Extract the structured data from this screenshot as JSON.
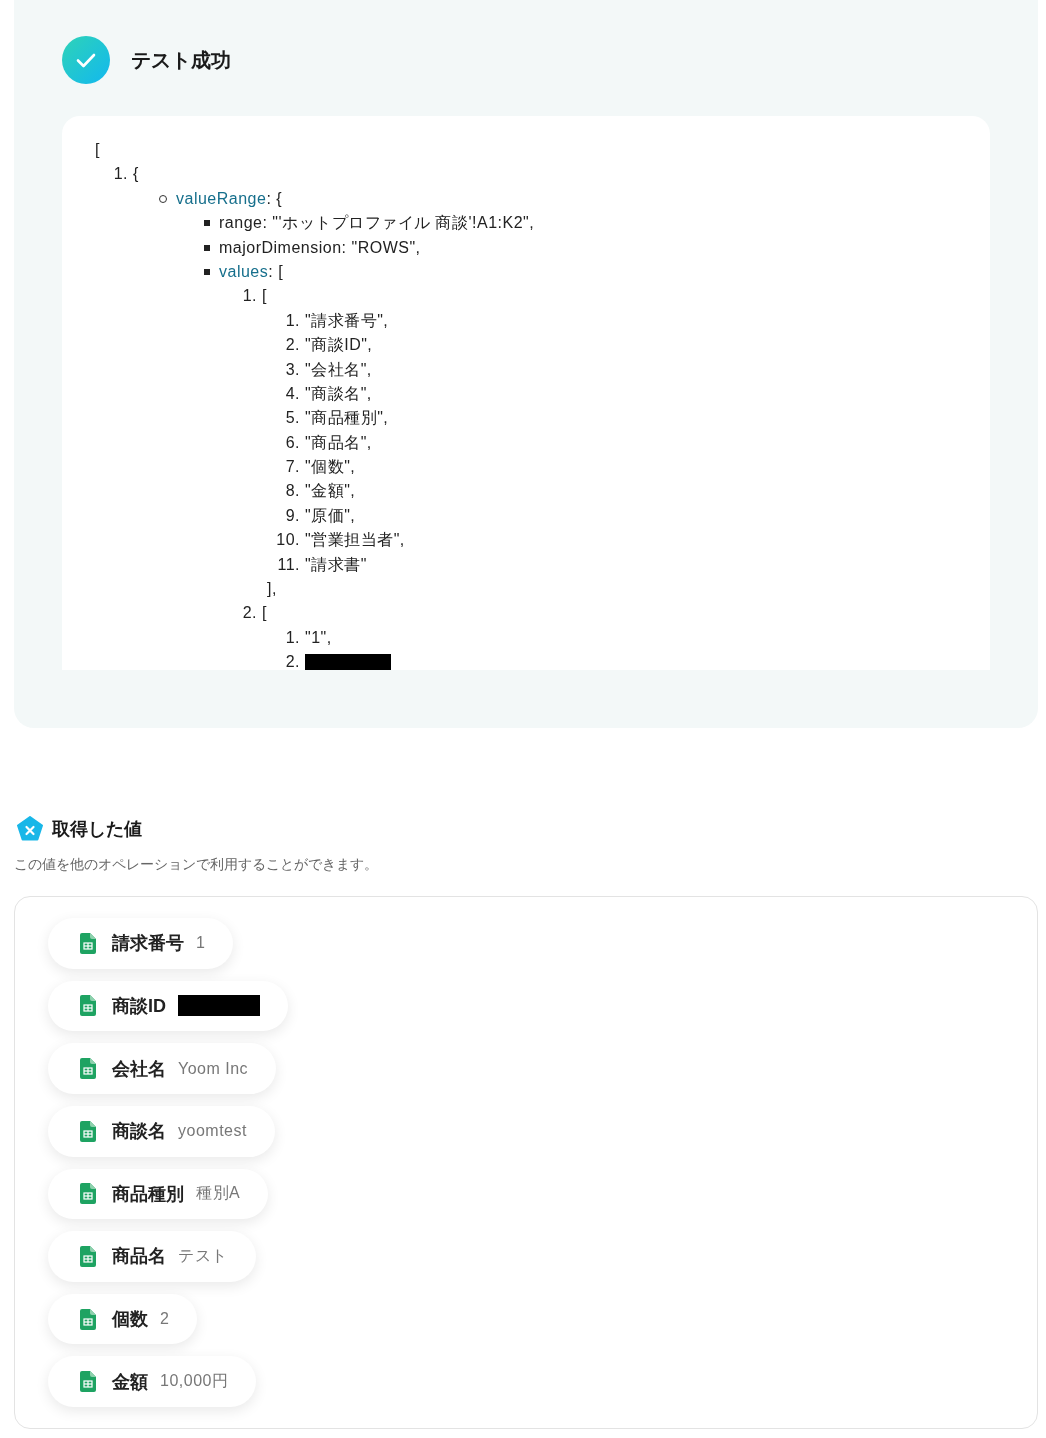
{
  "result": {
    "title": "テスト成功",
    "code": {
      "open": "[",
      "items": [
        {
          "kind": "numbered",
          "number": "1.",
          "text": "{",
          "children": [
            {
              "kind": "circle",
              "key": "valueRange",
              "text": ": {",
              "children": [
                {
                  "kind": "square",
                  "text": "range: \"'ホットプロファイル 商談'!A1:K2\","
                },
                {
                  "kind": "square",
                  "text": "majorDimension: \"ROWS\","
                },
                {
                  "kind": "square",
                  "key": "values",
                  "text": ": [",
                  "children": [
                    {
                      "kind": "numbered",
                      "number": "1.",
                      "text": "[",
                      "close": "],",
                      "children": [
                        {
                          "kind": "numbered",
                          "number": "1.",
                          "text": "\"請求番号\","
                        },
                        {
                          "kind": "numbered",
                          "number": "2.",
                          "text": "\"商談ID\","
                        },
                        {
                          "kind": "numbered",
                          "number": "3.",
                          "text": "\"会社名\","
                        },
                        {
                          "kind": "numbered",
                          "number": "4.",
                          "text": "\"商談名\","
                        },
                        {
                          "kind": "numbered",
                          "number": "5.",
                          "text": "\"商品種別\","
                        },
                        {
                          "kind": "numbered",
                          "number": "6.",
                          "text": "\"商品名\","
                        },
                        {
                          "kind": "numbered",
                          "number": "7.",
                          "text": "\"個数\","
                        },
                        {
                          "kind": "numbered",
                          "number": "8.",
                          "text": "\"金額\","
                        },
                        {
                          "kind": "numbered",
                          "number": "9.",
                          "text": "\"原価\","
                        },
                        {
                          "kind": "numbered",
                          "number": "10.",
                          "text": "\"営業担当者\","
                        },
                        {
                          "kind": "numbered",
                          "number": "11.",
                          "text": "\"請求書\""
                        }
                      ]
                    },
                    {
                      "kind": "numbered",
                      "number": "2.",
                      "text": "[",
                      "children": [
                        {
                          "kind": "numbered",
                          "number": "1.",
                          "text": "\"1\","
                        },
                        {
                          "kind": "numbered",
                          "number": "2.",
                          "redacted": true
                        }
                      ]
                    }
                  ]
                }
              ]
            }
          ]
        }
      ]
    }
  },
  "values_section": {
    "title": "取得した値",
    "description": "この値を他のオペレーションで利用することができます。",
    "fields": [
      {
        "label": "請求番号",
        "value": "1"
      },
      {
        "label": "商談ID",
        "redacted": true
      },
      {
        "label": "会社名",
        "value": "Yoom Inc"
      },
      {
        "label": "商談名",
        "value": "yoomtest"
      },
      {
        "label": "商品種別",
        "value": "種別A"
      },
      {
        "label": "商品名",
        "value": "テスト"
      },
      {
        "label": "個数",
        "value": "2"
      },
      {
        "label": "金額",
        "value": "10,000円"
      }
    ]
  }
}
